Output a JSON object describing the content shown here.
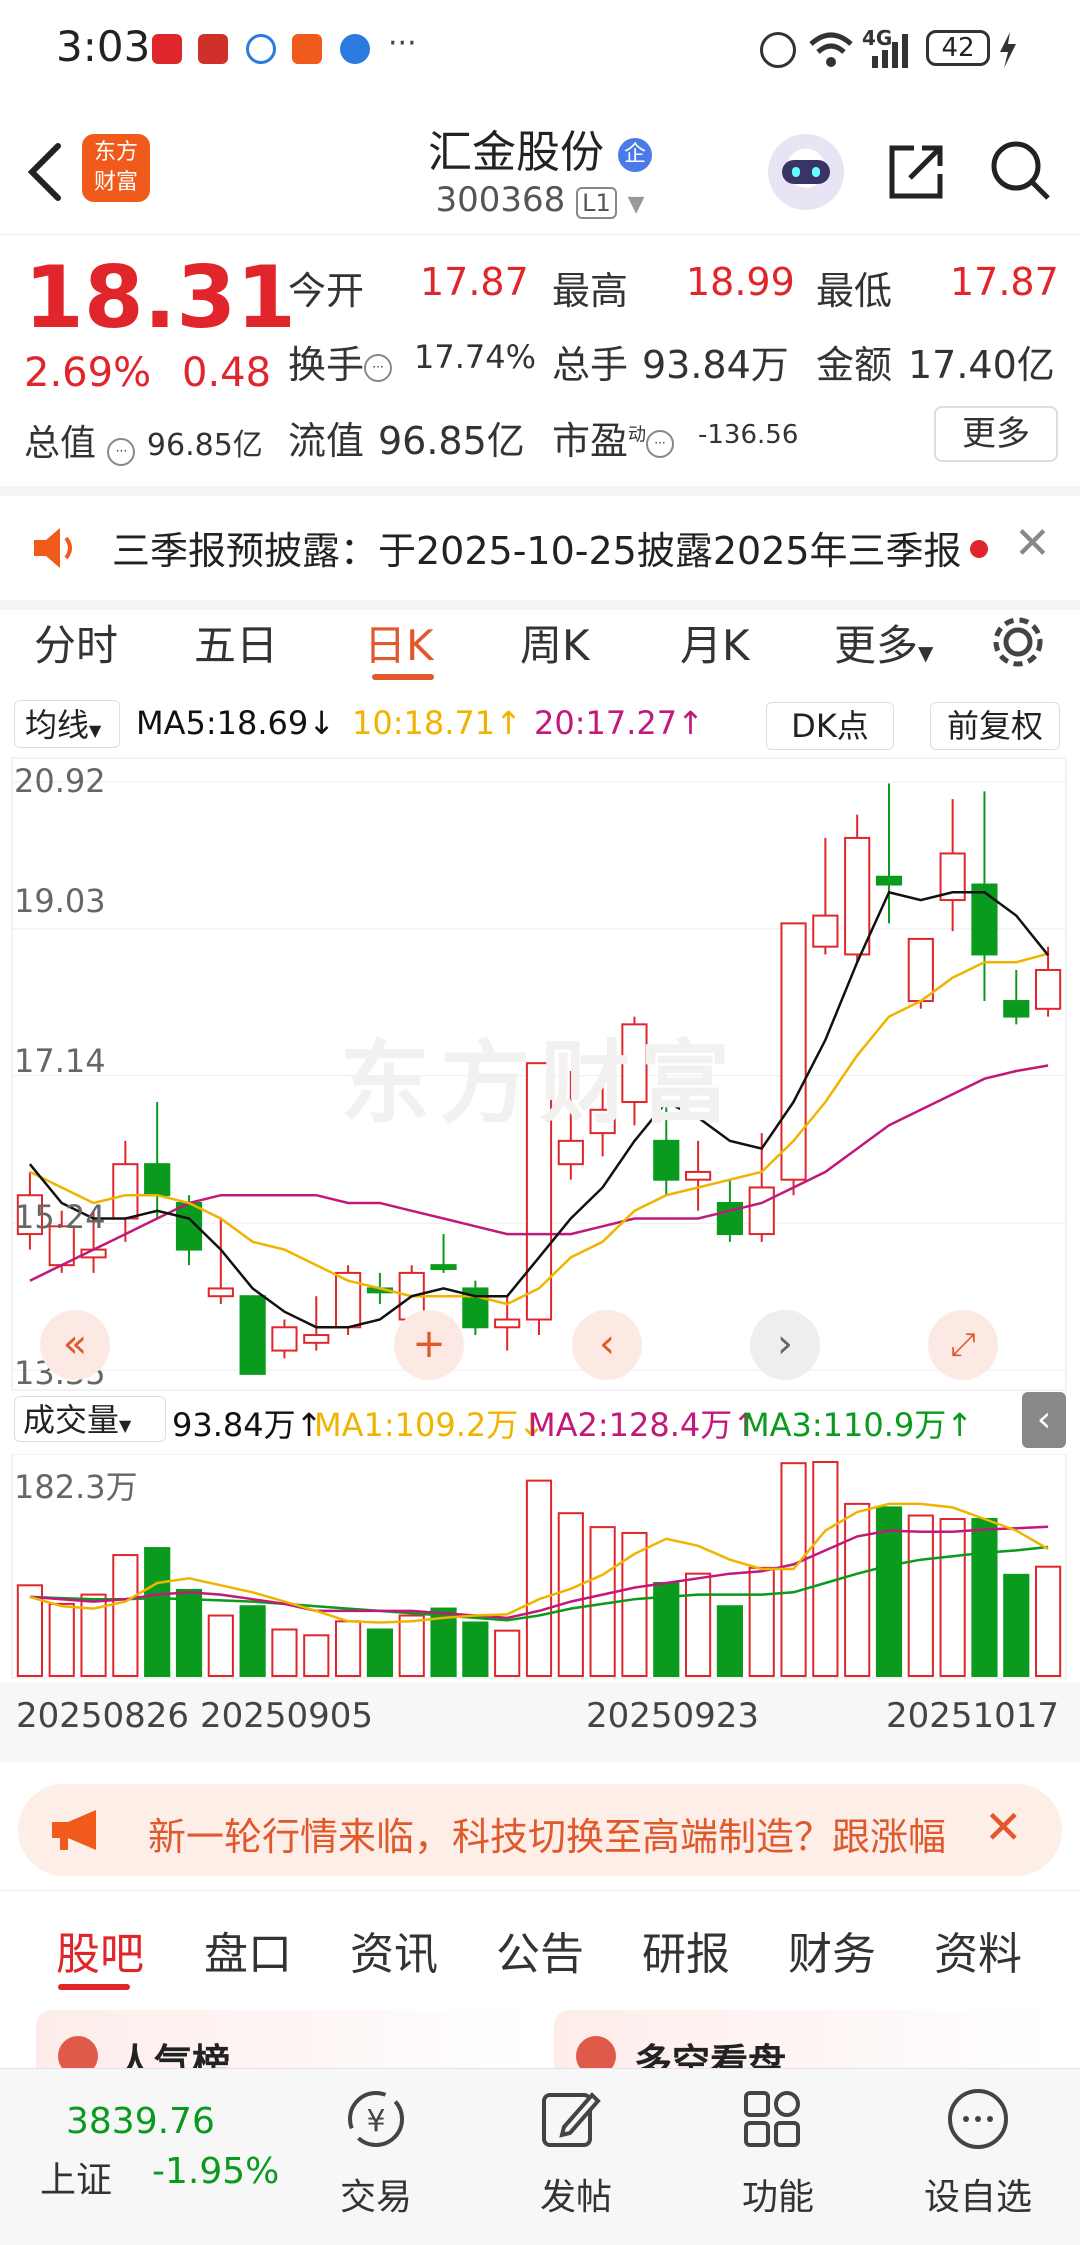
{
  "status_bar": {
    "time": "3:03",
    "battery": "42",
    "network": "4G",
    "more": "···"
  },
  "header": {
    "logo_line1": "东方",
    "logo_line2": "财富",
    "stock_name": "汇金股份",
    "badge": "企",
    "stock_code": "300368",
    "level": "L1"
  },
  "quote": {
    "price": "18.31",
    "change_pct": "2.69%",
    "change": "0.48",
    "open_label": "今开",
    "open": "17.87",
    "high_label": "最高",
    "high": "18.99",
    "low_label": "最低",
    "low": "17.87",
    "turnover_label": "换手",
    "turnover": "17.74%",
    "volume_label": "总手",
    "volume": "93.84万",
    "amount_label": "金额",
    "amount": "17.40亿",
    "mcap_label": "总值",
    "mcap": "96.85亿",
    "float_label": "流值",
    "float_mcap": "96.85亿",
    "pe_label": "市盈",
    "pe_sup": "动",
    "pe": "-136.56",
    "more_button": "更多"
  },
  "notice": {
    "text": "三季报预披露：于2025-10-25披露2025年三季报"
  },
  "ktabs": [
    "分时",
    "五日",
    "日K",
    "周K",
    "月K",
    "更多"
  ],
  "ma_bar": {
    "selector": "均线",
    "ma5": "MA5:18.69↓",
    "ma10": "10:18.71↑",
    "ma20": "20:17.27↑",
    "dk": "DK点",
    "adjust": "前复权"
  },
  "watermark": "东方财富",
  "vol_bar": {
    "selector": "成交量",
    "vol": "93.84万↑",
    "ma1": "MA1:109.2万↓",
    "ma2": "MA2:128.4万↑",
    "ma3": "MA3:110.9万↑"
  },
  "chart_data": {
    "type": "candlestick",
    "price_ticks": [
      "20.92",
      "19.03",
      "17.14",
      "15.24",
      "13.35"
    ],
    "ylim": [
      13.35,
      20.92
    ],
    "volume_max_label": "182.3万",
    "volume_max": 182.3,
    "date_labels": [
      "20250826",
      "20250905",
      "20250923",
      "20251017"
    ],
    "candles": [
      {
        "o": 15.1,
        "c": 15.6,
        "h": 15.9,
        "l": 14.9
      },
      {
        "o": 14.7,
        "c": 15.2,
        "h": 15.4,
        "l": 14.6
      },
      {
        "o": 14.8,
        "c": 14.9,
        "h": 15.4,
        "l": 14.6
      },
      {
        "o": 15.3,
        "c": 16.0,
        "h": 16.3,
        "l": 15.0
      },
      {
        "o": 16.0,
        "c": 15.6,
        "h": 16.8,
        "l": 15.3
      },
      {
        "o": 15.5,
        "c": 14.9,
        "h": 15.6,
        "l": 14.7
      },
      {
        "o": 14.3,
        "c": 14.4,
        "h": 15.3,
        "l": 14.2
      },
      {
        "o": 14.3,
        "c": 13.3,
        "h": 14.3,
        "l": 13.3
      },
      {
        "o": 13.6,
        "c": 13.9,
        "h": 14.0,
        "l": 13.5
      },
      {
        "o": 13.7,
        "c": 13.8,
        "h": 14.3,
        "l": 13.6
      },
      {
        "o": 13.9,
        "c": 14.6,
        "h": 14.7,
        "l": 13.8
      },
      {
        "o": 14.4,
        "c": 14.35,
        "h": 14.6,
        "l": 14.2
      },
      {
        "o": 14.0,
        "c": 14.6,
        "h": 14.7,
        "l": 13.9
      },
      {
        "o": 14.7,
        "c": 14.65,
        "h": 15.1,
        "l": 14.6
      },
      {
        "o": 14.4,
        "c": 13.9,
        "h": 14.5,
        "l": 13.8
      },
      {
        "o": 13.9,
        "c": 14.0,
        "h": 14.3,
        "l": 13.6
      },
      {
        "o": 14.0,
        "c": 17.3,
        "h": 17.3,
        "l": 13.8
      },
      {
        "o": 16.0,
        "c": 16.3,
        "h": 17.2,
        "l": 15.8
      },
      {
        "o": 16.4,
        "c": 16.7,
        "h": 17.2,
        "l": 16.1
      },
      {
        "o": 16.8,
        "c": 17.8,
        "h": 17.9,
        "l": 16.5
      },
      {
        "o": 16.3,
        "c": 15.8,
        "h": 16.8,
        "l": 15.6
      },
      {
        "o": 15.8,
        "c": 15.9,
        "h": 16.3,
        "l": 15.4
      },
      {
        "o": 15.5,
        "c": 15.1,
        "h": 15.8,
        "l": 15.0
      },
      {
        "o": 15.1,
        "c": 15.7,
        "h": 16.4,
        "l": 15.0
      },
      {
        "o": 15.8,
        "c": 19.1,
        "h": 19.1,
        "l": 15.6
      },
      {
        "o": 18.8,
        "c": 19.2,
        "h": 20.2,
        "l": 18.7
      },
      {
        "o": 18.7,
        "c": 20.2,
        "h": 20.5,
        "l": 18.6
      },
      {
        "o": 19.7,
        "c": 19.6,
        "h": 20.9,
        "l": 19.1
      },
      {
        "o": 18.1,
        "c": 18.9,
        "h": 18.9,
        "l": 18.0
      },
      {
        "o": 19.4,
        "c": 20.0,
        "h": 20.7,
        "l": 19.0
      },
      {
        "o": 19.6,
        "c": 18.7,
        "h": 20.8,
        "l": 18.1
      },
      {
        "o": 18.1,
        "c": 17.9,
        "h": 18.5,
        "l": 17.8
      },
      {
        "o": 18.0,
        "c": 18.5,
        "h": 18.8,
        "l": 17.9
      }
    ],
    "volumes": [
      78,
      62,
      70,
      104,
      110,
      74,
      52,
      60,
      40,
      35,
      47,
      40,
      52,
      58,
      46,
      39,
      168,
      140,
      128,
      123,
      80,
      88,
      60,
      93,
      183,
      184,
      148,
      145,
      138,
      135,
      135,
      87,
      94
    ],
    "ma5": [
      16.0,
      15.5,
      15.3,
      15.3,
      15.4,
      15.3,
      14.9,
      14.4,
      14.1,
      13.9,
      13.9,
      14.0,
      14.3,
      14.4,
      14.3,
      14.3,
      14.8,
      15.3,
      15.7,
      16.3,
      16.8,
      16.6,
      16.3,
      16.2,
      16.8,
      17.6,
      18.6,
      19.5,
      19.4,
      19.5,
      19.5,
      19.2,
      18.69
    ],
    "ma10": [
      15.9,
      15.7,
      15.5,
      15.6,
      15.6,
      15.5,
      15.3,
      15.0,
      14.9,
      14.7,
      14.5,
      14.4,
      14.3,
      14.3,
      14.3,
      14.2,
      14.4,
      14.8,
      15.0,
      15.4,
      15.6,
      15.7,
      15.8,
      15.9,
      16.3,
      16.8,
      17.4,
      17.9,
      18.1,
      18.4,
      18.6,
      18.6,
      18.71
    ],
    "ma20": [
      14.5,
      14.7,
      14.9,
      15.1,
      15.3,
      15.5,
      15.6,
      15.6,
      15.6,
      15.6,
      15.5,
      15.5,
      15.4,
      15.3,
      15.2,
      15.1,
      15.1,
      15.1,
      15.2,
      15.3,
      15.3,
      15.3,
      15.4,
      15.5,
      15.7,
      15.9,
      16.2,
      16.5,
      16.7,
      16.9,
      17.1,
      17.2,
      17.27
    ],
    "vma1": [
      68,
      60,
      58,
      64,
      80,
      84,
      78,
      72,
      64,
      56,
      47,
      46,
      47,
      50,
      52,
      53,
      66,
      75,
      87,
      105,
      118,
      112,
      100,
      92,
      92,
      125,
      141,
      148,
      148,
      145,
      135,
      125,
      109.2
    ],
    "vma2": [
      68,
      66,
      64,
      66,
      70,
      72,
      70,
      66,
      62,
      56,
      56,
      56,
      56,
      54,
      52,
      50,
      56,
      64,
      70,
      76,
      80,
      84,
      88,
      90,
      96,
      108,
      120,
      125,
      124,
      124,
      126,
      127,
      128.4
    ],
    "vma3": [
      68,
      67,
      66,
      66,
      67,
      66,
      65,
      64,
      62,
      60,
      58,
      56,
      54,
      52,
      50,
      48,
      52,
      58,
      62,
      66,
      68,
      70,
      70,
      70,
      72,
      80,
      88,
      95,
      100,
      103,
      106,
      108,
      110.9
    ]
  },
  "ad_banner": {
    "text": "新一轮行情来临，科技切换至高端制造？跟涨幅"
  },
  "section_tabs": [
    "股吧",
    "盘口",
    "资讯",
    "公告",
    "研报",
    "财务",
    "资料"
  ],
  "cards": {
    "left": "人气榜",
    "right": "多空看盘"
  },
  "bottom_nav": {
    "index_value": "3839.76",
    "index_name": "上证",
    "index_change": "-1.95%",
    "trade": "交易",
    "post": "发帖",
    "functions": "功能",
    "watchlist": "设自选"
  },
  "colors": {
    "up": "#e0262b",
    "down": "#0a9a1d",
    "accent": "#e0582b",
    "ma5": "#111111",
    "ma10": "#f0b400",
    "ma20": "#c2187a",
    "vma3": "#0a9a1d"
  }
}
